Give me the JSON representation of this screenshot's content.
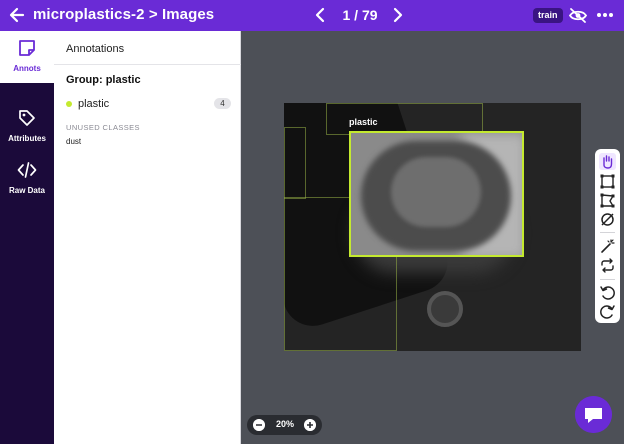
{
  "header": {
    "title": "microplastics-2 > Images",
    "pager": "1 / 79",
    "badge": "train"
  },
  "nav": [
    {
      "label": "Annots",
      "icon": "note-icon",
      "active": true
    },
    {
      "label": "Attributes",
      "icon": "tag-icon",
      "active": false
    },
    {
      "label": "Raw Data",
      "icon": "code-icon",
      "active": false
    }
  ],
  "panel": {
    "title": "Annotations",
    "group": "Group: plastic",
    "class_name": "plastic",
    "class_count": "4",
    "class_color": "#c4ea2f",
    "unused_title": "UNUSED CLASSES",
    "unused_item": "dust"
  },
  "canvas": {
    "annotation_label": "plastic",
    "zoom": "20%",
    "minus": "−",
    "plus": "+"
  },
  "colors": {
    "brand": "#6a2bd6",
    "nav_bg": "#1b0a3a",
    "canvas_bg": "#4d5057",
    "annotation": "#c4ea2f"
  },
  "tools": [
    "hand-icon",
    "bounding-box-icon",
    "polygon-icon",
    "null-icon",
    "magic-wand-icon",
    "repeat-icon",
    "undo-icon",
    "redo-icon"
  ]
}
